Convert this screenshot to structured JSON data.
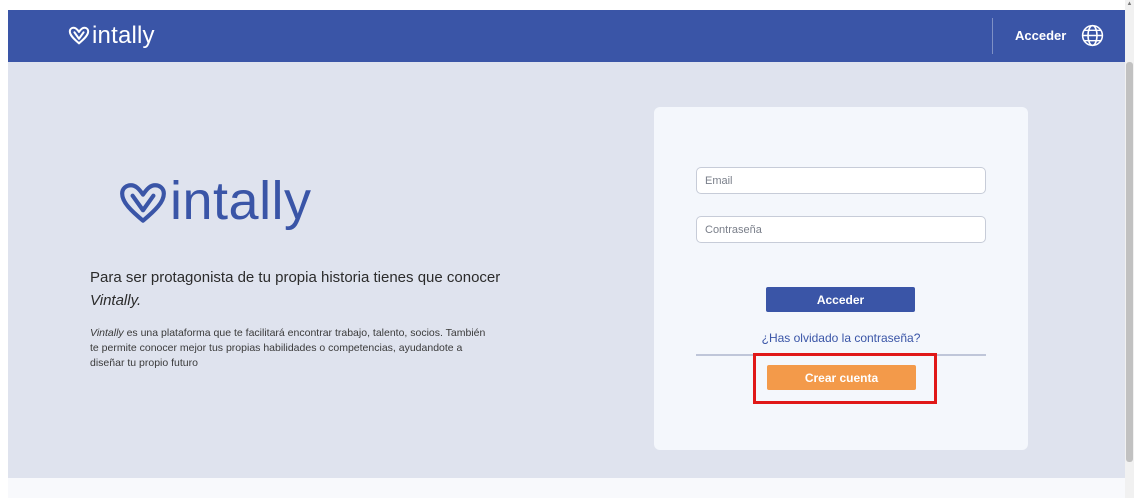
{
  "header": {
    "brand": "intally",
    "login_label": "Acceder",
    "globe_icon": "globe-icon"
  },
  "hero": {
    "brand": "intally",
    "heading_prefix": "Para ser protagonista de tu propia historia tienes que conocer ",
    "heading_brand": "Vintally.",
    "text_brand": "Vintally",
    "text_body": " es una plataforma que te facilitará encontrar trabajo, talento, socios. También te permite conocer mejor tus propias habilidades o competencias, ayudandote a diseñar tu propio futuro"
  },
  "login": {
    "email_placeholder": "Email",
    "password_placeholder": "Contraseña",
    "submit_label": "Acceder",
    "forgot_label": "¿Has olvidado la contraseña?",
    "create_account_label": "Crear cuenta"
  },
  "colors": {
    "primary": "#3a55a7",
    "accent": "#f39a4a",
    "highlight": "#e01818",
    "hero_bg": "#dfe3ee",
    "card_bg": "#f4f7fc"
  }
}
